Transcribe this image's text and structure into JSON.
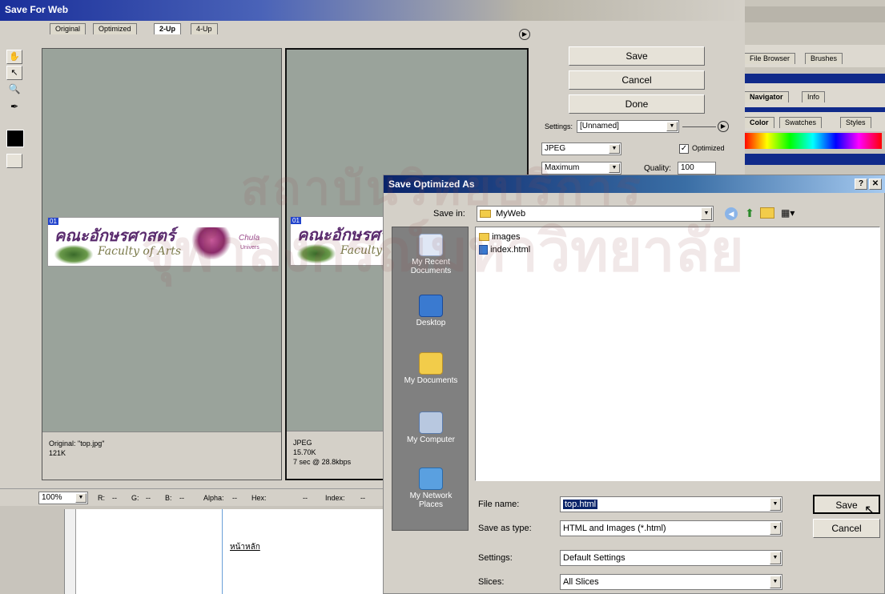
{
  "sfw": {
    "title": "Save For Web",
    "tabs": [
      "Original",
      "Optimized",
      "2-Up",
      "4-Up"
    ],
    "buttons": {
      "save": "Save",
      "cancel": "Cancel",
      "done": "Done"
    },
    "settings_label": "Settings:",
    "settings_value": "[Unnamed]",
    "format": "JPEG",
    "optimized_label": "Optimized",
    "quality_preset": "Maximum",
    "quality_label": "Quality:",
    "quality_value": "100",
    "left_pane": {
      "line1": "Original: \"top.jpg\"",
      "line2": "121K"
    },
    "right_pane": {
      "line1": "JPEG",
      "line2": "15.70K",
      "line3": "7 sec @ 28.8kbps"
    },
    "zoom": "100%",
    "status": {
      "r": "R:",
      "g": "G:",
      "b": "B:",
      "alpha": "Alpha:",
      "hex": "Hex:",
      "index": "Index:",
      "dash": "--"
    },
    "banner": {
      "thai": "คณะอักษรศาสตร์",
      "english": "Faculty of Arts",
      "chula": "Chula",
      "univ": "Univers",
      "slice": "01"
    },
    "canvas_text": "หน้าหลัก"
  },
  "palettes": {
    "tabs_top": [
      "File Browser",
      "Brushes"
    ],
    "tabs_nav": [
      "Navigator",
      "Info"
    ],
    "tabs_color": [
      "Color",
      "Swatches",
      "Styles"
    ]
  },
  "dialog": {
    "title": "Save Optimized As",
    "title_buttons": "?|X",
    "save_in_label": "Save in:",
    "save_in_value": "MyWeb",
    "places": [
      "My Recent Documents",
      "Desktop",
      "My Documents",
      "My Computer",
      "My Network Places"
    ],
    "files": [
      "images",
      "index.html"
    ],
    "filename_label": "File name:",
    "filename_value": "top.html",
    "savetype_label": "Save as type:",
    "savetype_value": "HTML and Images (*.html)",
    "settings_label": "Settings:",
    "settings_value": "Default Settings",
    "slices_label": "Slices:",
    "slices_value": "All Slices",
    "save_button": "Save",
    "cancel_button": "Cancel"
  },
  "watermark": {
    "line1": "สถาบันวิทยบริการ",
    "line2": "จุฬาลงกรณ์มหาวิทยาลัย"
  }
}
